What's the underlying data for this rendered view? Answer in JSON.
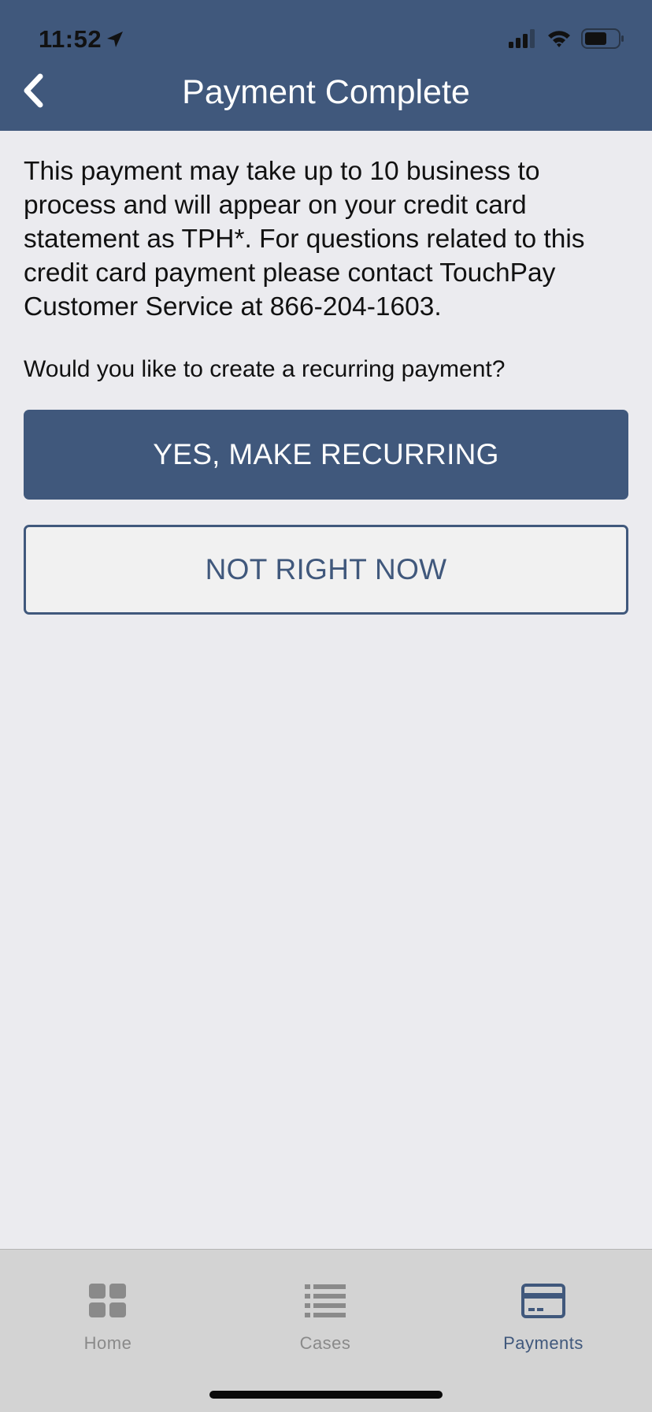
{
  "status_bar": {
    "time": "11:52"
  },
  "nav": {
    "title": "Payment Complete"
  },
  "content": {
    "message": "This payment may take up to 10 business to process and will appear on your credit card statement as TPH*. For questions related to this credit card payment please contact TouchPay Customer Service at 866-204-1603.",
    "question": "Would you like to create a recurring payment?"
  },
  "buttons": {
    "primary_label": "YES, MAKE RECURRING",
    "secondary_label": "NOT RIGHT NOW"
  },
  "tab_bar": {
    "selected": "Payments",
    "items": [
      {
        "label": "Home",
        "icon": "grid-icon"
      },
      {
        "label": "Cases",
        "icon": "list-icon"
      },
      {
        "label": "Payments",
        "icon": "credit-card-icon"
      }
    ]
  },
  "colors": {
    "header": "#40587c",
    "accent": "#40587c",
    "background": "#ebebef",
    "tab_bar": "#d3d3d3",
    "inactive_tab": "#8a8a8a"
  }
}
